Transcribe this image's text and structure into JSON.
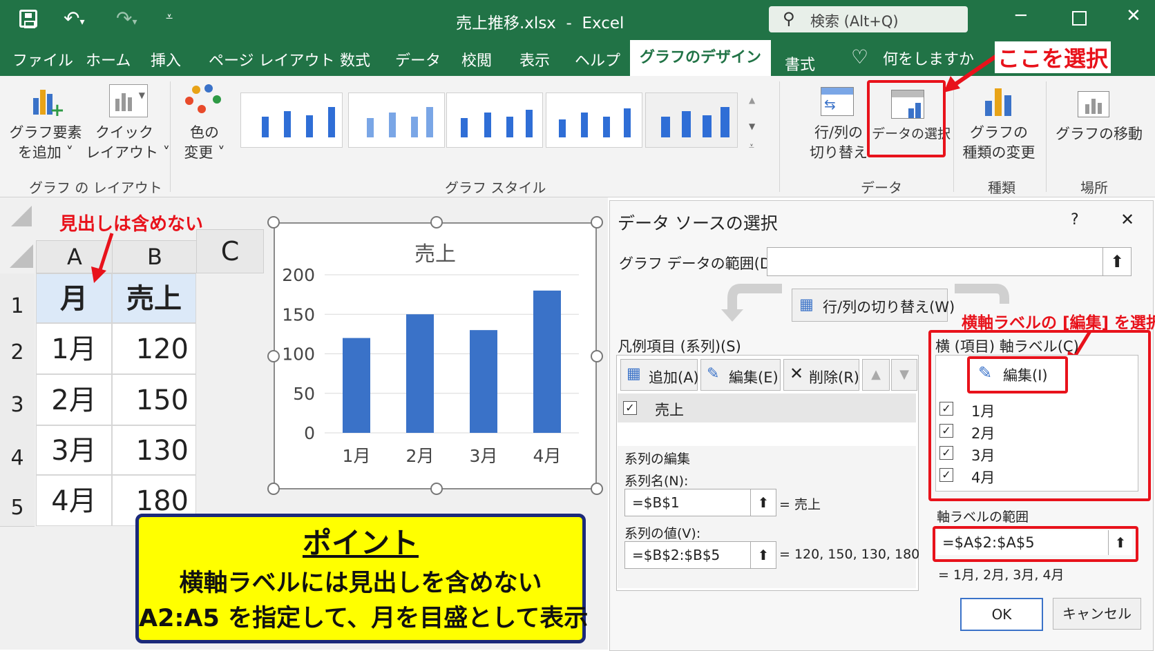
{
  "titlebar": {
    "title": "売上推移.xlsx  -  Excel",
    "search_placeholder": "検索 (Alt+Q)"
  },
  "tabs": [
    "ファイル",
    "ホーム",
    "挿入",
    "ページ レイアウト",
    "数式",
    "データ",
    "校閲",
    "表示",
    "ヘルプ",
    "グラフのデザイン",
    "書式"
  ],
  "tell_me": "何をしますか",
  "ribbon": {
    "add_element": [
      "グラフ要素",
      "を追加 ˅"
    ],
    "quick_layout": [
      "クイック",
      "レイアウト ˅"
    ],
    "color_change": [
      "色の",
      "変更 ˅"
    ],
    "group_layout": "グラフ の レイアウト",
    "group_style": "グラフ スタイル",
    "switch_rowcol": [
      "行/列の",
      "切り替え"
    ],
    "select_data": "データの選択",
    "group_data": "データ",
    "change_type": [
      "グラフの",
      "種類の変更"
    ],
    "group_type": "種類",
    "move_chart": "グラフの移動",
    "group_location": "場所"
  },
  "annotations": {
    "select_here": "ここを選択",
    "no_header": "見出しは含めない",
    "edit_axis": "横軸ラベルの [編集] を選択"
  },
  "sheet": {
    "columns": [
      "A",
      "B",
      "C"
    ],
    "rows": [
      "1",
      "2",
      "3",
      "4",
      "5"
    ],
    "cells": [
      [
        "月",
        "売上"
      ],
      [
        "1月",
        "120"
      ],
      [
        "2月",
        "150"
      ],
      [
        "3月",
        "130"
      ],
      [
        "4月",
        "180"
      ]
    ]
  },
  "chart_data": {
    "type": "bar",
    "title": "売上",
    "categories": [
      "1月",
      "2月",
      "3月",
      "4月"
    ],
    "values": [
      120,
      150,
      130,
      180
    ],
    "yticks": [
      "200",
      "150",
      "100",
      "50",
      "0"
    ],
    "ylim": [
      0,
      200
    ],
    "color": "#3a72c8"
  },
  "dialog": {
    "title": "データ ソースの選択",
    "help": "?",
    "close": "✕",
    "range_label": "グラフ データの範囲(D):",
    "range_value": "",
    "switch_btn": "行/列の切り替え(W)",
    "series_header": "凡例項目 (系列)(S)",
    "add_btn": "追加(A)",
    "edit_btn": "編集(E)",
    "delete_btn": "削除(R)",
    "series_item": "売上",
    "series_edit": "系列の編集",
    "series_name_label": "系列名(N):",
    "series_name_value": "=$B$1",
    "series_name_result": "= 売上",
    "series_values_label": "系列の値(V):",
    "series_values_value": "=$B$2:$B$5",
    "series_values_result": "= 120, 150, 130, 180",
    "axis_header": "横 (項目) 軸ラベル(C)",
    "axis_edit_btn": "編集(I)",
    "axis_items": [
      "1月",
      "2月",
      "3月",
      "4月"
    ],
    "axis_range_label": "軸ラベルの範囲",
    "axis_range_value": "=$A$2:$A$5",
    "axis_range_result": "= 1月, 2月, 3月, 4月",
    "ok": "OK",
    "cancel": "キャンセル"
  },
  "point": {
    "title": "ポイント",
    "line1": "横軸ラベルには見出しを含めない",
    "line2": "A2:A5 を指定して、月を目盛として表示"
  }
}
